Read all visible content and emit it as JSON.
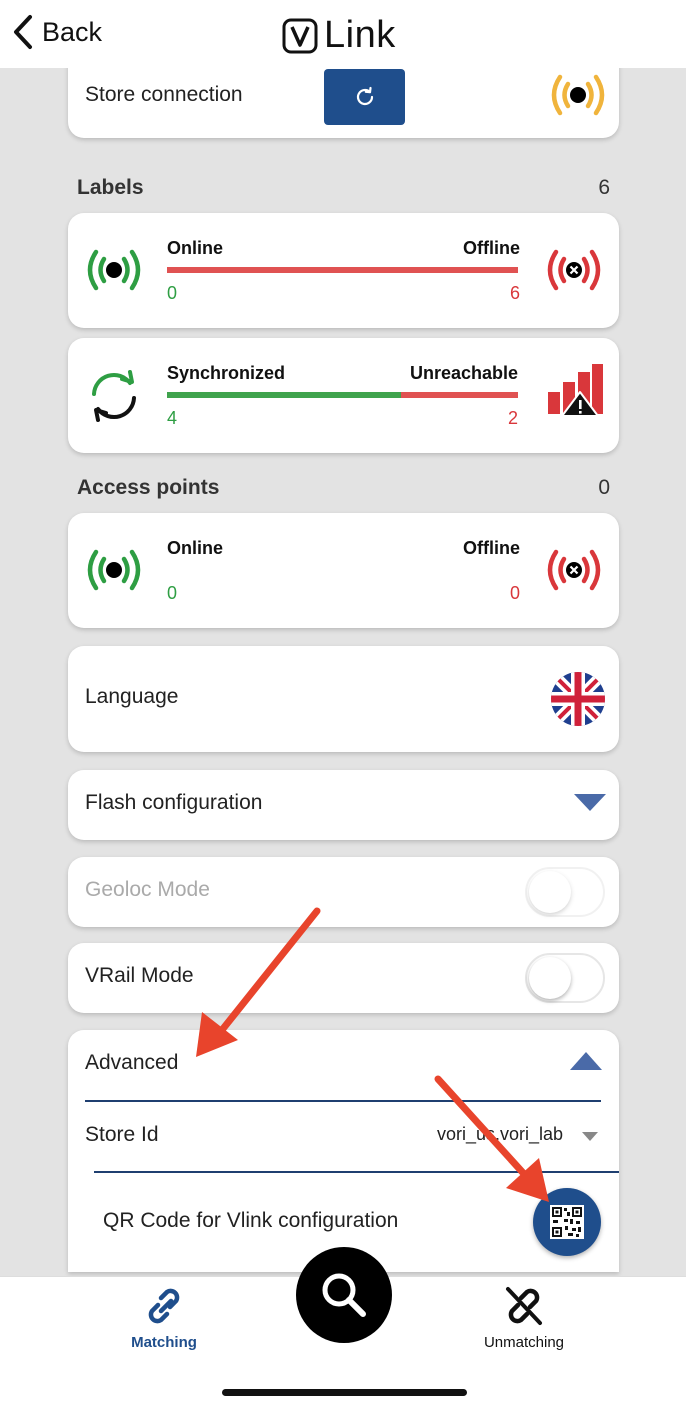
{
  "header": {
    "back_label": "Back",
    "app_name": "Link"
  },
  "store_connection": {
    "label": "Store connection"
  },
  "labels_section": {
    "title": "Labels",
    "count": "6",
    "online_offline": {
      "online_label": "Online",
      "offline_label": "Offline",
      "online_value": "0",
      "offline_value": "6"
    },
    "sync": {
      "synced_label": "Synchronized",
      "unreachable_label": "Unreachable",
      "synced_value": "4",
      "unreachable_value": "2"
    }
  },
  "access_points": {
    "title": "Access points",
    "count": "0",
    "online_label": "Online",
    "offline_label": "Offline",
    "online_value": "0",
    "offline_value": "0"
  },
  "language": {
    "label": "Language",
    "flag": "uk-flag-icon"
  },
  "flash": {
    "label": "Flash configuration"
  },
  "geoloc": {
    "label": "Geoloc Mode",
    "enabled": false
  },
  "vrail": {
    "label": "VRail Mode",
    "enabled": false
  },
  "advanced": {
    "label": "Advanced",
    "store_id_label": "Store Id",
    "store_id_value": "vori_us.vori_lab",
    "qr_label": "QR Code for Vlink configuration"
  },
  "bottom_nav": {
    "matching_label": "Matching",
    "unmatching_label": "Unmatching"
  },
  "colors": {
    "accent": "#1f4e8c",
    "online": "#2e9e43",
    "offline": "#d9373b",
    "warning": "#f0b43c"
  }
}
